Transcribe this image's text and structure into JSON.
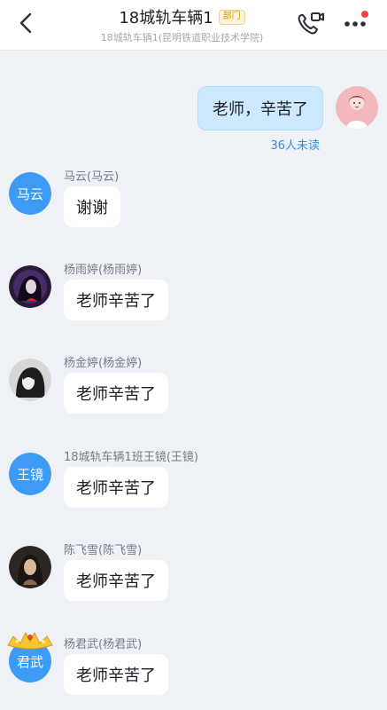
{
  "header": {
    "title": "18城轨车辆1",
    "badge": "部门",
    "subtitle": "18城轨车辆1(昆明铁道职业技术学院)",
    "back_icon": "chevron-left-icon",
    "call_icon": "video-call-icon",
    "more_icon": "more-dots-icon"
  },
  "colors": {
    "accent": "#3d9bf5",
    "self_bubble": "#cde8ff",
    "unread": "#2f8fe6",
    "badge_bg": "#fff4d6",
    "notification_dot": "#f0443a"
  },
  "self_message": {
    "text": "老师，辛苦了",
    "unread": "36人未读"
  },
  "messages": [
    {
      "sender": "马云(马云)",
      "avatar_text": "马云",
      "text": "谢谢"
    },
    {
      "sender": "杨雨婷(杨雨婷)",
      "avatar_text": "",
      "text": "老师辛苦了"
    },
    {
      "sender": "杨金婷(杨金婷)",
      "avatar_text": "",
      "text": "老师辛苦了"
    },
    {
      "sender": "18城轨车辆1班王镜(王镜)",
      "avatar_text": "王镜",
      "text": "老师辛苦了"
    },
    {
      "sender": "陈飞雪(陈飞雪)",
      "avatar_text": "",
      "text": "老师辛苦了"
    },
    {
      "sender": "杨君武(杨君武)",
      "avatar_text": "君武",
      "text": "老师辛苦了"
    }
  ]
}
